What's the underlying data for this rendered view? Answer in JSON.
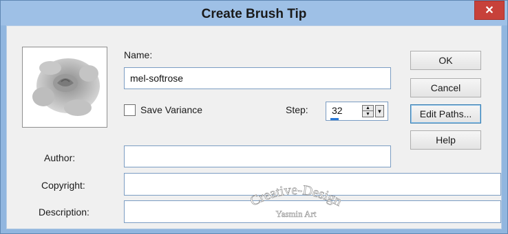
{
  "window": {
    "title": "Create Brush Tip"
  },
  "form": {
    "name_label": "Name:",
    "name_value": "mel-softrose",
    "save_variance_label": "Save Variance",
    "save_variance_checked": false,
    "step_label": "Step:",
    "step_value": "32",
    "step_level_fraction": 0.1,
    "author_label": "Author:",
    "author_value": "",
    "copyright_label": "Copyright:",
    "copyright_value": "",
    "description_label": "Description:",
    "description_value": ""
  },
  "buttons": {
    "ok": "OK",
    "cancel": "Cancel",
    "edit_paths": "Edit Paths...",
    "help": "Help",
    "close": "✕"
  },
  "watermark": {
    "line1": "Creative-Design",
    "line2": "Yasmin Art"
  },
  "icons": {
    "close": "close-icon",
    "spin_up": "chevron-up-icon",
    "spin_down": "chevron-down-icon",
    "dropdown": "dropdown-arrow-icon"
  },
  "colors": {
    "titlebar": "#9ec0e6",
    "close_button": "#c7413a",
    "dialog_bg": "#f0f0f0",
    "focus_border": "#3c7fb1"
  }
}
